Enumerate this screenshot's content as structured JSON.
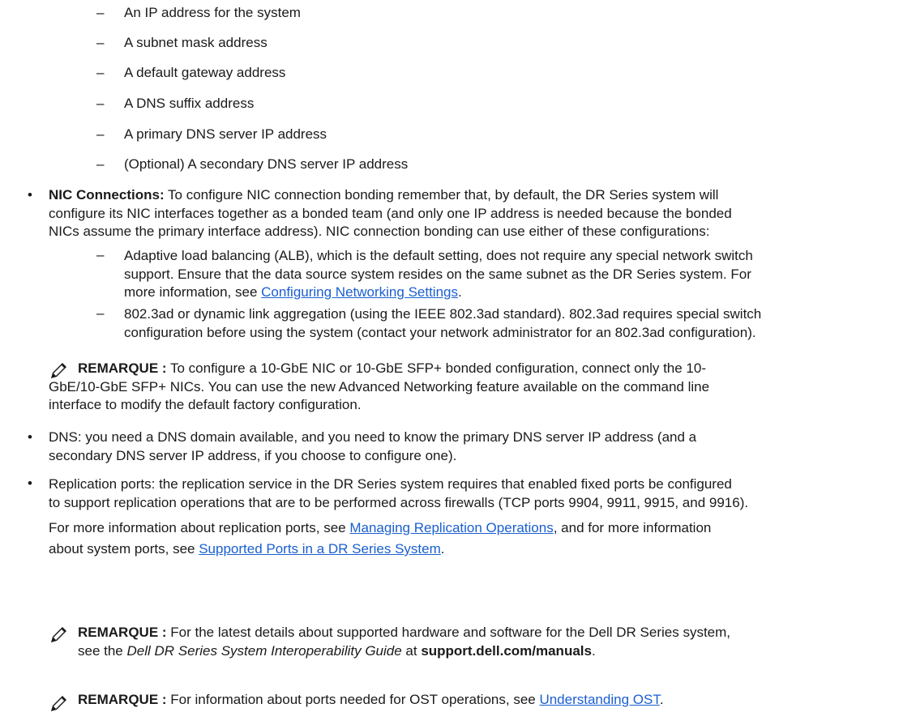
{
  "sub_items": [
    "An IP address for the system",
    "A subnet mask address",
    "A default gateway address",
    "A DNS suffix address",
    "A primary DNS server IP address",
    "(Optional) A secondary DNS server IP address"
  ],
  "dash_glyph": "–",
  "bullet_glyph": "•",
  "nic": {
    "label": "NIC Connections:",
    "line1": " To configure NIC connection bonding remember that, by default, the DR Series system will",
    "line2": "configure its NIC interfaces together as a bonded team (and only one IP address is needed because the bonded",
    "line3": "NICs assume the primary interface address). NIC connection bonding can use either of these configurations:"
  },
  "alb": {
    "line1": "Adaptive load balancing (ALB), which is the default setting, does not require any special network switch",
    "line2": "support. Ensure that the data source system resides on the same subnet as the DR Series system. For",
    "line3_pre": "more information, see ",
    "link": "Configuring Networking Settings",
    "line3_post": "."
  },
  "lacp": {
    "line1": "802.3ad or dynamic link aggregation (using the IEEE 802.3ad standard). 802.3ad requires special switch",
    "line2": "configuration before using the system (contact your network administrator for an 802.3ad configuration)."
  },
  "note1": {
    "label": "REMARQUE :",
    "line1": " To configure a 10-GbE NIC or 10-GbE SFP+ bonded configuration, connect only the 10-",
    "line2": "GbE/10-GbE SFP+ NICs. You can use the new Advanced Networking feature available on the command line",
    "line3": "interface to modify the default factory configuration."
  },
  "dns": {
    "line1": "DNS: you need a DNS domain available, and you need to know the primary DNS server IP address (and a",
    "line2": "secondary DNS server IP address, if you choose to configure one)."
  },
  "replication": {
    "line1": "Replication ports: the replication service in the DR Series system requires that enabled fixed ports be configured",
    "line2": "to support replication operations that are to be performed across firewalls (TCP ports 9904, 9911, 9915, and 9916).",
    "line3_pre": "For more information about replication ports, see ",
    "link1": "Managing Replication Operations",
    "line3_post": ", and for more information",
    "line4_pre": "about system ports, see ",
    "link2": "Supported Ports in a DR Series System",
    "line4_post": "."
  },
  "note2": {
    "label": "REMARQUE :",
    "line1": " For the latest details about supported hardware and software for the Dell DR Series system,",
    "line2_pre": "see the ",
    "guide": "Dell DR Series System Interoperability Guide",
    "line2_mid": " at ",
    "site": "support.dell.com/manuals",
    "line2_post": "."
  },
  "note3": {
    "label": "REMARQUE :",
    "text_pre": " For information about ports needed for OST operations, see ",
    "link": "Understanding OST",
    "text_post": "."
  }
}
